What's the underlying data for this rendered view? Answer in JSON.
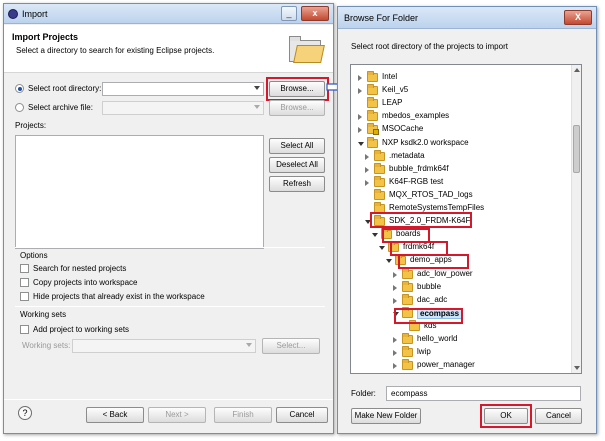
{
  "import_dialog": {
    "title": "Import",
    "header_title": "Import Projects",
    "header_desc": "Select a directory to search for existing Eclipse projects.",
    "root_dir_label": "Select root directory:",
    "archive_label": "Select archive file:",
    "browse_label": "Browse...",
    "projects_label": "Projects:",
    "select_all": "Select All",
    "deselect_all": "Deselect All",
    "refresh": "Refresh",
    "options_title": "Options",
    "opt_nested": "Search for nested projects",
    "opt_copy": "Copy projects into workspace",
    "opt_hide": "Hide projects that already exist in the workspace",
    "working_sets_title": "Working sets",
    "add_working": "Add project to working sets",
    "working_sets_label": "Working sets:",
    "select_btn": "Select...",
    "help": "?",
    "back": "< Back",
    "next": "Next >",
    "finish": "Finish",
    "cancel": "Cancel"
  },
  "browse_dialog": {
    "title": "Browse For Folder",
    "close": "X",
    "desc": "Select root directory of the projects to import",
    "tree": [
      {
        "label": "Intel",
        "state": "closed",
        "lock": false
      },
      {
        "label": "Keil_v5",
        "state": "closed",
        "lock": false
      },
      {
        "label": "LEAP",
        "state": "none",
        "lock": false
      },
      {
        "label": "mbedos_examples",
        "state": "closed",
        "lock": false
      },
      {
        "label": "MSOCache",
        "state": "closed",
        "lock": true
      },
      {
        "label": "NXP ksdk2.0 workspace",
        "state": "open",
        "lock": false
      },
      {
        "label": ".metadata",
        "state": "closed",
        "lock": false
      },
      {
        "label": "bubble_frdmk64f",
        "state": "closed",
        "lock": false
      },
      {
        "label": "K64F-RGB test",
        "state": "closed",
        "lock": false
      },
      {
        "label": "MQX_RTOS_TAD_logs",
        "state": "none",
        "lock": false
      },
      {
        "label": "RemoteSystemsTempFiles",
        "state": "none",
        "lock": false
      },
      {
        "label": "SDK_2.0_FRDM-K64F",
        "state": "open",
        "lock": false
      },
      {
        "label": "boards",
        "state": "open",
        "lock": false
      },
      {
        "label": "frdmk64f",
        "state": "open",
        "lock": false
      },
      {
        "label": "demo_apps",
        "state": "open",
        "lock": false
      },
      {
        "label": "adc_low_power",
        "state": "closed",
        "lock": false
      },
      {
        "label": "bubble",
        "state": "closed",
        "lock": false
      },
      {
        "label": "dac_adc",
        "state": "closed",
        "lock": false
      },
      {
        "label": "ecompass",
        "state": "open",
        "lock": false
      },
      {
        "label": "kds",
        "state": "none",
        "lock": false
      },
      {
        "label": "hello_world",
        "state": "closed",
        "lock": false
      },
      {
        "label": "lwip",
        "state": "closed",
        "lock": false
      },
      {
        "label": "power_manager",
        "state": "closed",
        "lock": false
      }
    ],
    "folder_label": "Folder:",
    "folder_value": "ecompass",
    "make_new_folder": "Make New Folder",
    "ok": "OK",
    "cancel": "Cancel"
  },
  "colors": {
    "highlight": "#d3192b",
    "arrow": "#2f56c6",
    "selection": "#cde3f7"
  }
}
